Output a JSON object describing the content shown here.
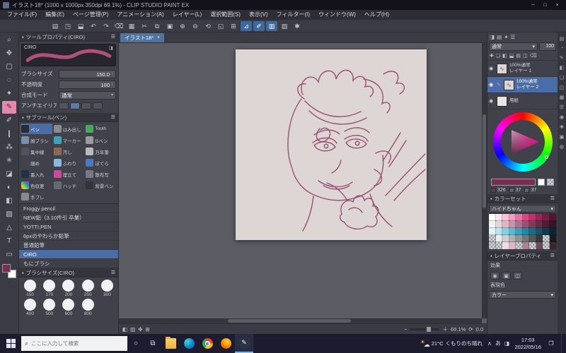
{
  "title_bar": {
    "title": "イラスト18* (1000 x 1000px 350dpi 69.1%) - CLIP STUDIO PAINT EX",
    "window_controls": [
      "─",
      "□",
      "×"
    ]
  },
  "menu_bar": {
    "items": [
      "ファイル(F)",
      "編集(E)",
      "ページ管理(P)",
      "アニメーション(A)",
      "レイヤー(L)",
      "選択範囲(S)",
      "表示(V)",
      "フィルター(I)",
      "ウィンドウ(W)",
      "ヘルプ(H)"
    ]
  },
  "toolbar": {
    "icons": [
      {
        "name": "new-file-icon",
        "glyph": "▤",
        "active": false
      },
      {
        "name": "open-file-icon",
        "glyph": "◳",
        "active": false
      },
      {
        "name": "save-icon",
        "glyph": "⬓",
        "active": false
      },
      {
        "name": "undo-icon",
        "glyph": "↶",
        "active": false
      },
      {
        "name": "redo-icon",
        "glyph": "↷",
        "active": false
      },
      {
        "name": "delete-icon",
        "glyph": "⌫",
        "active": false
      },
      {
        "name": "deselect-icon",
        "glyph": "▦",
        "active": false
      },
      {
        "name": "cut-icon",
        "glyph": "✂",
        "active": false
      },
      {
        "name": "copy-icon",
        "glyph": "⧉",
        "active": false
      },
      {
        "name": "paste-icon",
        "glyph": "▣",
        "active": false
      },
      {
        "name": "zoom-in-icon",
        "glyph": "⊕",
        "active": false
      },
      {
        "name": "zoom-out-icon",
        "glyph": "⊖",
        "active": false
      },
      {
        "name": "rotate-view-icon",
        "glyph": "⟲",
        "active": false
      },
      {
        "name": "fit-screen-icon",
        "glyph": "◱",
        "active": false
      },
      {
        "name": "grid-icon",
        "glyph": "⊞",
        "active": false
      },
      {
        "name": "snap-ruler-icon",
        "glyph": "⊿",
        "active": true
      },
      {
        "name": "snap-special-ruler-icon",
        "glyph": "✐",
        "active": true
      },
      {
        "name": "snap-guide-icon",
        "glyph": "▥",
        "active": true
      },
      {
        "name": "material-icon",
        "glyph": "▨",
        "active": false
      },
      {
        "name": "settings-icon",
        "glyph": "✱",
        "active": false
      }
    ]
  },
  "tool_strip": {
    "icons": [
      {
        "name": "zoom-tool-icon",
        "glyph": "⌕",
        "active": false
      },
      {
        "name": "move-tool-icon",
        "glyph": "✥",
        "active": false
      },
      {
        "name": "selection-tool-icon",
        "glyph": "▢",
        "active": false
      },
      {
        "name": "lasso-tool-icon",
        "glyph": "◌",
        "active": false
      },
      {
        "name": "wand-tool-icon",
        "glyph": "✦",
        "active": false
      },
      {
        "name": "pen-tool-icon",
        "glyph": "✎",
        "active": true
      },
      {
        "name": "pencil-tool-icon",
        "glyph": "✐",
        "active": false
      },
      {
        "name": "brush-tool-icon",
        "glyph": "❙",
        "active": false
      },
      {
        "name": "airbrush-tool-icon",
        "glyph": "⁂",
        "active": false
      },
      {
        "name": "decoration-tool-icon",
        "glyph": "✳",
        "active": false
      },
      {
        "name": "eraser-tool-icon",
        "glyph": "◪",
        "active": false
      },
      {
        "name": "blend-tool-icon",
        "glyph": "◐",
        "active": false
      },
      {
        "name": "fill-tool-icon",
        "glyph": "◧",
        "active": false
      },
      {
        "name": "gradient-tool-icon",
        "glyph": "▨",
        "active": false
      },
      {
        "name": "figure-tool-icon",
        "glyph": "△",
        "active": false
      },
      {
        "name": "text-tool-icon",
        "glyph": "T",
        "active": false
      },
      {
        "name": "frame-tool-icon",
        "glyph": "▭",
        "active": false
      }
    ]
  },
  "tool_property": {
    "title": "ツールプロパティ(CIRO)",
    "brush_name": "CIRO",
    "fields": [
      {
        "label": "ブラシサイズ",
        "value": "150.0"
      },
      {
        "label": "不透明度",
        "value": "100"
      },
      {
        "label": "合成モード",
        "value": "通常"
      }
    ],
    "aa_label": "アンチエイリアス"
  },
  "sub_tool": {
    "title": "サブツール(ペン)",
    "cells": [
      {
        "label": "ペン",
        "color": "#2b2b31",
        "active": true
      },
      {
        "label": "はみ出し",
        "color": "#8a8a92",
        "active": false
      },
      {
        "label": "Tooth",
        "color": "#3fae5a",
        "active": false
      },
      {
        "label": "顔ブラシ",
        "color": "#7a8ea8",
        "active": false
      },
      {
        "label": "マーカー",
        "color": "#3fa0b8",
        "active": false
      },
      {
        "label": "Gペン",
        "color": "#9a9aa2",
        "active": false
      },
      {
        "label": "集中線",
        "color": "#52525a",
        "active": false
      },
      {
        "label": "汚し",
        "color": "#8a6a52",
        "active": false
      },
      {
        "label": "万年筆",
        "color": "#b8b8c0",
        "active": false
      },
      {
        "label": "細め",
        "color": "#42424a",
        "active": false
      },
      {
        "label": "ふわり",
        "color": "#8ab8d8",
        "active": false
      },
      {
        "label": "ぼてら",
        "color": "#4a78c8",
        "active": false
      },
      {
        "label": "墨入れ",
        "color": "#223048",
        "active": false
      },
      {
        "label": "埋立て",
        "color": "#c84a98",
        "active": false
      },
      {
        "label": "散布写",
        "color": "#78788a",
        "active": false
      },
      {
        "label": "色収差",
        "color": "rainbow",
        "active": false
      },
      {
        "label": "ハッチ",
        "color": "#68686e",
        "active": false
      },
      {
        "label": "背景ペン",
        "color": "#32323a",
        "active": false
      },
      {
        "label": "手ブレ",
        "color": "#88888e",
        "active": false
      }
    ],
    "brushes": [
      "Froggy pencil",
      "NEW鉛（3.10件引 卒業）",
      "YOTTI.PEN",
      "6pxのやわらか鉛筆",
      "普通鉛筆",
      "CIRO",
      "もにブラシ"
    ],
    "selected_index": 5
  },
  "brush_size_panel": {
    "title": "ブラシサイズ(CIRO)",
    "sizes": [
      "150",
      "170",
      "200",
      "250",
      "300",
      "400",
      "500",
      "600",
      "800"
    ]
  },
  "canvas": {
    "tab": "イラスト18*",
    "close": "×",
    "zoom": "69.1%",
    "rotation": "0.0",
    "status_icons": [
      "◧",
      "▥",
      "✥",
      "⊞"
    ],
    "ink_color": "#8d3f66",
    "paper_color": "#ded5d5"
  },
  "right_panel": {
    "header_icons": [
      "◨",
      "▤",
      "✦",
      "☰"
    ],
    "blend_mode": "通常",
    "opacity": "100",
    "ops_icons": [
      "✚",
      "❏",
      "◧",
      "⬓",
      "▤",
      "◫",
      "⌫"
    ],
    "layers": [
      {
        "percent": "100%通常",
        "name": "レイヤー 1",
        "selected": false
      },
      {
        "percent": "100%通常",
        "name": "レイヤー 2",
        "selected": true
      },
      {
        "percent": "",
        "name": "用紙",
        "selected": false
      }
    ],
    "color_numbers": [
      {
        "swatch": "#7b2c50",
        "value": "326"
      },
      {
        "swatch": "#62626c",
        "value": "37"
      },
      {
        "swatch": "#62626c",
        "value": "37"
      }
    ]
  },
  "color_set": {
    "title": "カラーセット",
    "preset": "ハイドちゃん",
    "palette": [
      "#ffffff",
      "#fce4ef",
      "#f8c3da",
      "#f39bc2",
      "#ec6fa6",
      "#dd4589",
      "#c22e6f",
      "#9e2457",
      "#7a1b42",
      "#58132f",
      "#f2f2f2",
      "#e8d6de",
      "#d9b7c6",
      "#c693ab",
      "#b06f8f",
      "#985274",
      "#7d3c5c",
      "#632c47",
      "#4a1f34",
      "#331523",
      "#dff4f8",
      "#b5e6ef",
      "#84d3e3",
      "#54bcd4",
      "#2fa3c1",
      "#2187a6",
      "#1a6c88",
      "#13536b",
      "#0d3c4f",
      "#082735",
      "checker",
      "#ececec",
      "#cfcfcf",
      "#b1b1b1",
      "#939393",
      "#757575",
      "#575757",
      "#393939",
      "checker",
      "#1b1b1b",
      "checker",
      "checker",
      "#f2d9e4",
      "#ddb6c8",
      "checker",
      "#b07f97",
      "checker",
      "#6f4a5e",
      "checker",
      "#3a2531"
    ]
  },
  "layer_property": {
    "title": "レイヤープロパティ",
    "effect_label": "効果",
    "effect_icons": [
      "◉",
      "▣",
      "◫"
    ],
    "expression_label": "表現色",
    "expression_value": "カラー"
  },
  "far_strip": {
    "icons": [
      "▤",
      "◔",
      "✎",
      "◧",
      "❏",
      "◫",
      "▦",
      "☰",
      "◉",
      "✚",
      "▣",
      "◍"
    ]
  },
  "taskbar": {
    "search_placeholder": "ここに入力して検索",
    "cortana_glyph": "○",
    "taskview_glyph": "⧉",
    "apps": [
      {
        "name": "file-explorer-icon",
        "type": "folder",
        "running": false
      },
      {
        "name": "edge-icon",
        "type": "edge",
        "running": false
      },
      {
        "name": "chrome-icon",
        "type": "chrome",
        "running": false
      },
      {
        "name": "firefox-icon",
        "type": "firefox",
        "running": false
      },
      {
        "name": "clip-studio-icon",
        "type": "clip",
        "running": true
      }
    ],
    "weather_temp": "21°C",
    "weather_text": "くもりのち晴れ",
    "tray_icons": [
      "∧",
      "あ",
      "◨"
    ],
    "time": "17:03",
    "date": "2022/05/16",
    "notification_glyph": "❐"
  }
}
